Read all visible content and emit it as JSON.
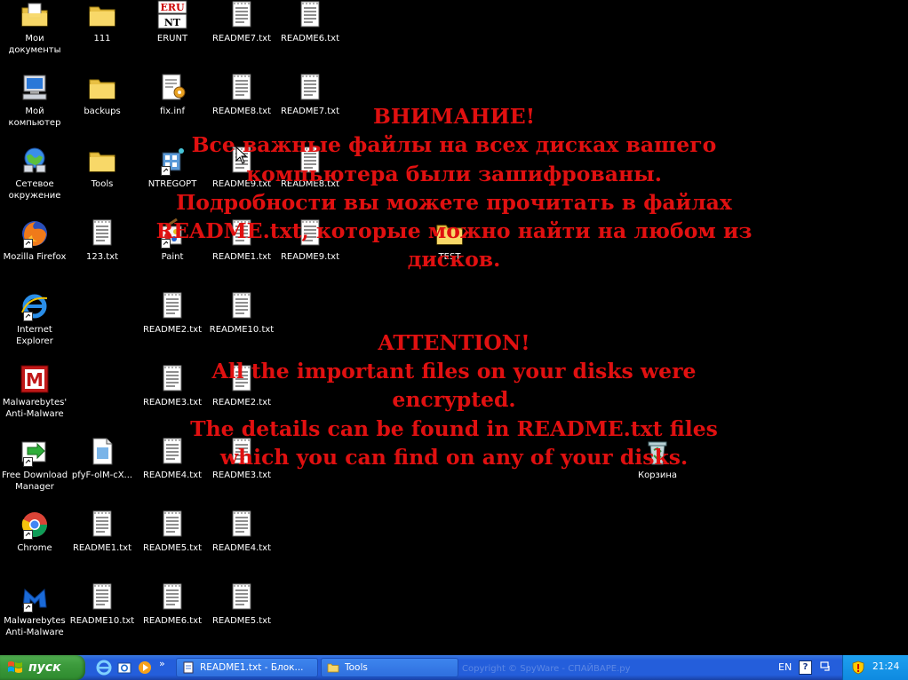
{
  "colors": {
    "desktop_bg": "#000000",
    "ransom_text": "#e01010",
    "taskbar": "#245edb",
    "start_button": "#3c9a3c",
    "tray": "#0e8ae0"
  },
  "desktop_icons": [
    {
      "label": "Мои документы",
      "icon": "my-documents-icon"
    },
    {
      "label": "111",
      "icon": "folder-icon"
    },
    {
      "label": "ERUNT",
      "icon": "erunt-icon"
    },
    {
      "label": "README7.txt",
      "icon": "text-file-icon"
    },
    {
      "label": "README6.txt",
      "icon": "text-file-icon"
    },
    {
      "label": "Мой компьютер",
      "icon": "my-computer-icon"
    },
    {
      "label": "backups",
      "icon": "folder-icon"
    },
    {
      "label": "fix.inf",
      "icon": "inf-file-icon"
    },
    {
      "label": "README8.txt",
      "icon": "text-file-icon"
    },
    {
      "label": "README7.txt",
      "icon": "text-file-icon"
    },
    {
      "label": "Сетевое окружение",
      "icon": "network-places-icon"
    },
    {
      "label": "Tools",
      "icon": "folder-icon"
    },
    {
      "label": "NTREGOPT",
      "icon": "ntregopt-icon"
    },
    {
      "label": "README9.txt",
      "icon": "text-file-icon"
    },
    {
      "label": "README8.txt",
      "icon": "text-file-icon"
    },
    {
      "label": "Mozilla Firefox",
      "icon": "firefox-icon"
    },
    {
      "label": "123.txt",
      "icon": "text-file-icon"
    },
    {
      "label": "Paint",
      "icon": "paint-icon"
    },
    {
      "label": "README1.txt",
      "icon": "text-file-icon"
    },
    {
      "label": "README9.txt",
      "icon": "text-file-icon"
    },
    {
      "label": "TEST",
      "icon": "folder-icon"
    },
    {
      "label": "Internet Explorer",
      "icon": "internet-explorer-icon"
    },
    {
      "label": "README2.txt",
      "icon": "text-file-icon"
    },
    {
      "label": "README10.txt",
      "icon": "text-file-icon"
    },
    {
      "label": "Malwarebytes' Anti-Malware",
      "icon": "malwarebytes-old-icon"
    },
    {
      "label": "README3.txt",
      "icon": "text-file-icon"
    },
    {
      "label": "README2.txt",
      "icon": "text-file-icon"
    },
    {
      "label": "Free Download Manager",
      "icon": "fdm-icon"
    },
    {
      "label": "pfyF-olM-cX...",
      "icon": "blank-file-icon"
    },
    {
      "label": "README4.txt",
      "icon": "text-file-icon"
    },
    {
      "label": "README3.txt",
      "icon": "text-file-icon"
    },
    {
      "label": "Корзина",
      "icon": "recycle-bin-icon"
    },
    {
      "label": "Chrome",
      "icon": "chrome-icon"
    },
    {
      "label": "README1.txt",
      "icon": "text-file-icon"
    },
    {
      "label": "README5.txt",
      "icon": "text-file-icon"
    },
    {
      "label": "README4.txt",
      "icon": "text-file-icon"
    },
    {
      "label": "Malwarebytes Anti-Malware",
      "icon": "malwarebytes-icon"
    },
    {
      "label": "README10.txt",
      "icon": "text-file-icon"
    },
    {
      "label": "README6.txt",
      "icon": "text-file-icon"
    },
    {
      "label": "README5.txt",
      "icon": "text-file-icon"
    }
  ],
  "ransom_note": {
    "ru_title": "ВНИМАНИЕ!",
    "ru_lines": [
      "Все важные файлы на всех дисках вашего",
      "компьютера были зашифрованы.",
      "Подробности вы можете прочитать в файлах",
      "README.txt, которые можно найти на любом из",
      "дисков."
    ],
    "en_title": "ATTENTION!",
    "en_lines": [
      "All the important files on your disks were",
      "encrypted.",
      "The details can be found in README.txt files",
      "which you can find on any of your disks."
    ]
  },
  "taskbar": {
    "start_label": "пуск",
    "quick_launch": [
      "internet-explorer-icon",
      "outlook-express-icon",
      "media-player-icon"
    ],
    "overflow_label": "»",
    "tasks": [
      {
        "label": "README1.txt - Блок...",
        "icon": "notepad-icon"
      },
      {
        "label": "Tools",
        "icon": "folder-icon"
      }
    ],
    "watermark": "Copyright © SpyWare - СПАЙВАРЕ.ру",
    "language": "EN",
    "help_label": "?",
    "clock": "21:24"
  }
}
